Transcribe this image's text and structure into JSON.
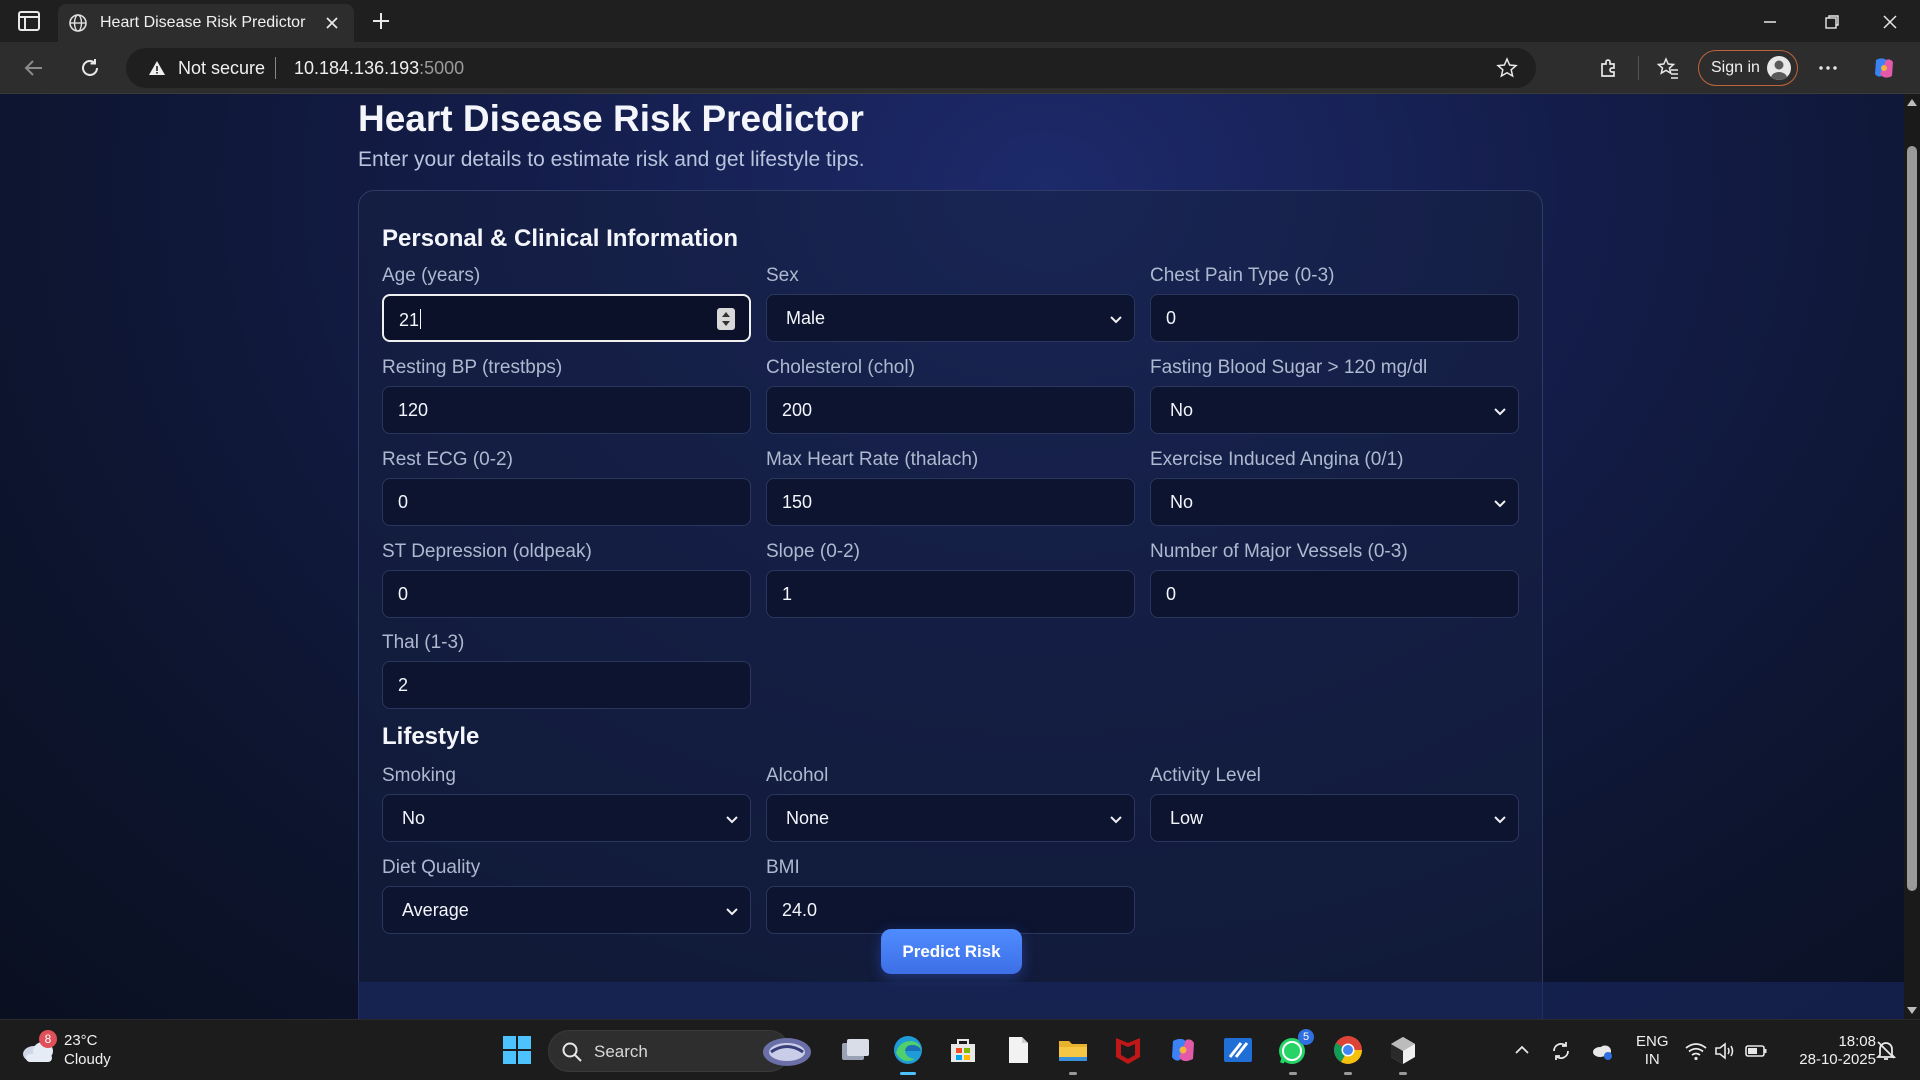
{
  "browser": {
    "tab_title": "Heart Disease Risk Predictor",
    "security_label": "Not secure",
    "url_host": "10.184.136.193",
    "url_port": ":5000",
    "signin_label": "Sign in"
  },
  "page": {
    "title": "Heart Disease Risk Predictor",
    "subtitle": "Enter your details to estimate risk and get lifestyle tips."
  },
  "clinical": {
    "section_title": "Personal & Clinical Information",
    "fields": [
      {
        "label": "Age (years)",
        "value": "21",
        "kind": "number",
        "focused": true
      },
      {
        "label": "Sex",
        "value": "Male",
        "kind": "select"
      },
      {
        "label": "Chest Pain Type (0-3)",
        "value": "0",
        "kind": "number"
      },
      {
        "label": "Resting BP (trestbps)",
        "value": "120",
        "kind": "number"
      },
      {
        "label": "Cholesterol (chol)",
        "value": "200",
        "kind": "number"
      },
      {
        "label": "Fasting Blood Sugar > 120 mg/dl",
        "value": "No",
        "kind": "select"
      },
      {
        "label": "Rest ECG (0-2)",
        "value": "0",
        "kind": "number"
      },
      {
        "label": "Max Heart Rate (thalach)",
        "value": "150",
        "kind": "number"
      },
      {
        "label": "Exercise Induced Angina (0/1)",
        "value": "No",
        "kind": "select"
      },
      {
        "label": "ST Depression (oldpeak)",
        "value": "0",
        "kind": "number"
      },
      {
        "label": "Slope (0-2)",
        "value": "1",
        "kind": "number"
      },
      {
        "label": "Number of Major Vessels (0-3)",
        "value": "0",
        "kind": "number"
      },
      {
        "label": "Thal (1-3)",
        "value": "2",
        "kind": "number"
      }
    ]
  },
  "lifestyle": {
    "section_title": "Lifestyle",
    "fields": [
      {
        "label": "Smoking",
        "value": "No",
        "kind": "select"
      },
      {
        "label": "Alcohol",
        "value": "None",
        "kind": "select"
      },
      {
        "label": "Activity Level",
        "value": "Low",
        "kind": "select"
      },
      {
        "label": "Diet Quality",
        "value": "Average",
        "kind": "select"
      },
      {
        "label": "BMI",
        "value": "24.0",
        "kind": "number"
      }
    ]
  },
  "actions": {
    "predict_label": "Predict Risk"
  },
  "taskbar": {
    "weather_temp": "23°C",
    "weather_cond": "Cloudy",
    "weather_badge": "8",
    "search_label": "Search",
    "whatsapp_badge": "5",
    "lang_line1": "ENG",
    "lang_line2": "IN",
    "time": "18:08",
    "date": "28-10-2025"
  },
  "colors": {
    "accent": "#4f8cff",
    "page_bg": "#141d4a",
    "input_bg": "#0c1430"
  }
}
